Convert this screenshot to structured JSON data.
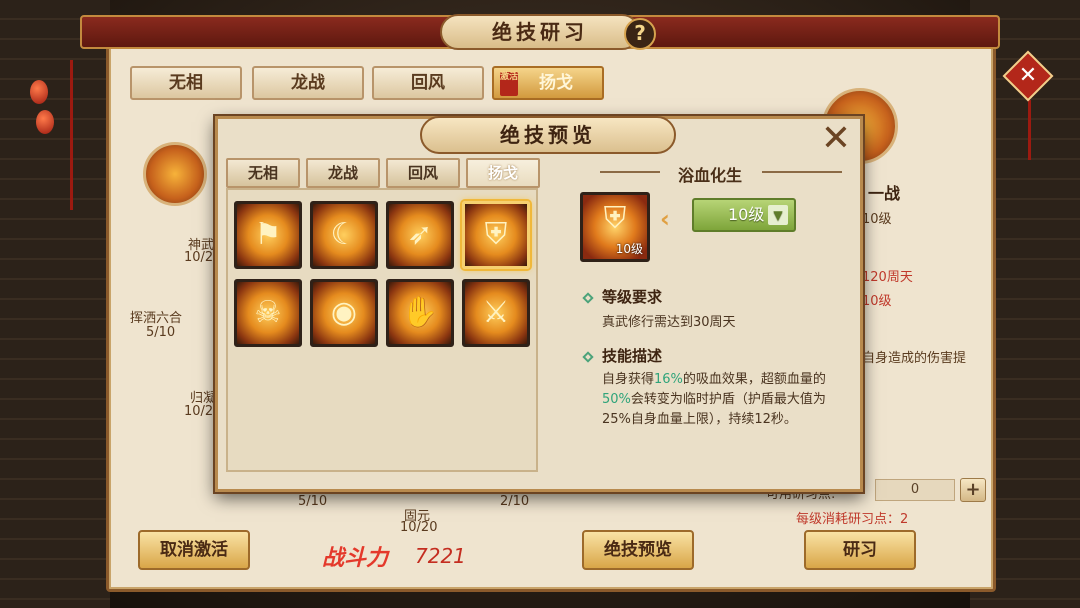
{
  "window": {
    "title": "绝技研习",
    "help_icon": "?",
    "main_tabs": [
      "无相",
      "龙战",
      "回风",
      "扬戈"
    ],
    "active_seal": "激活"
  },
  "left_nodes": {
    "node_a_label": "神武",
    "node_a_count": "10/20",
    "node_b_label": "挥洒六合",
    "node_b_count": "5/10",
    "node_c_label": "归凝",
    "node_c_count": "10/20",
    "node_d_count": "5/10",
    "node_e_label": "固元",
    "node_e_count": "10/20",
    "node_f_count": "2/10"
  },
  "right_info": {
    "skill_name_partial": "一战",
    "level_partial": "10级",
    "req_partial": "120周天",
    "req_level_partial": "10级",
    "desc_partial": "自身造成的伤害提",
    "points_label": "可用研习点:",
    "points_value": "0",
    "cost_text": "每级消耗研习点：2",
    "plus": "+"
  },
  "bottom": {
    "cancel_label": "取消激活",
    "preview_label": "绝技预览",
    "study_label": "研习",
    "power_label": "战斗力",
    "power_value": "7221"
  },
  "dialog": {
    "title": "绝技预览",
    "close": "✕",
    "tabs": [
      "无相",
      "龙战",
      "回风",
      "扬戈"
    ],
    "skill_name": "浴血化生",
    "icon_level": "10级",
    "selected_level": "10级",
    "level_req_head": "等级要求",
    "level_req_text": "真武修行需达到30周天",
    "desc_head": "技能描述",
    "desc_parts": {
      "p1": "自身获得",
      "pct1": "16%",
      "p2": "的吸血效果，超额血量的",
      "pct2": "50%",
      "p3": "会转变为临时护盾（护盾最大值为25%自身血量上限），持续12秒。"
    }
  },
  "skills": [
    {
      "name": "banner",
      "glyph": "⚑"
    },
    {
      "name": "crescent-slash",
      "glyph": "☾"
    },
    {
      "name": "bow",
      "glyph": "➶"
    },
    {
      "name": "blood-shield",
      "glyph": "⛨"
    },
    {
      "name": "demon-armor",
      "glyph": "☠"
    },
    {
      "name": "golden-bell",
      "glyph": "◉"
    },
    {
      "name": "fire-palm",
      "glyph": "✋"
    },
    {
      "name": "flame-sword",
      "glyph": "⚔"
    }
  ],
  "colors": {
    "accent_gold": "#d9a648",
    "title_red": "#8a2a1e",
    "level_green": "#7ea53a",
    "highlight_teal": "#2fa47a",
    "power_red": "#e4392b"
  }
}
